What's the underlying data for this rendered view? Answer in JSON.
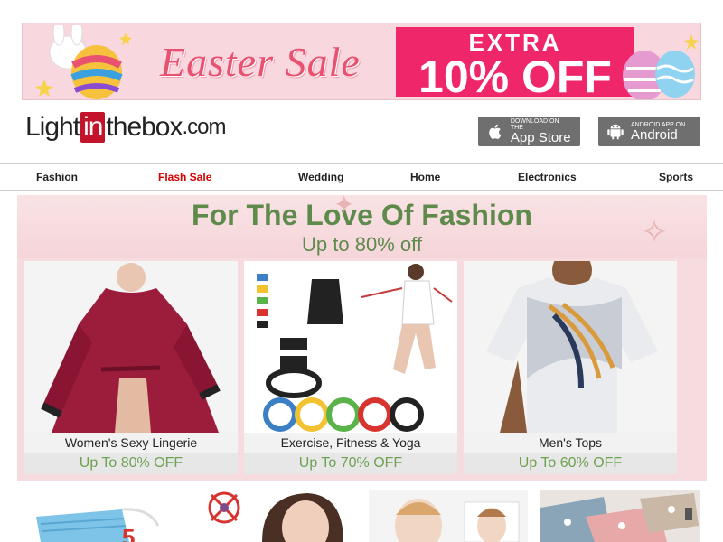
{
  "banner": {
    "title": "Easter Sale",
    "offer_line1": "EXTRA",
    "offer_line2": "10% OFF"
  },
  "header": {
    "logo_pre": "Light",
    "logo_in": "in",
    "logo_post": "thebox",
    "logo_tld": ".com",
    "appstore_small": "Download on the",
    "appstore_big": "App Store",
    "android_small": "ANDROID APP ON",
    "android_big": "Android"
  },
  "nav": {
    "items": [
      "Fashion",
      "Flash Sale",
      "Wedding",
      "Home",
      "Electronics",
      "Sports"
    ]
  },
  "promo": {
    "title": "For The Love Of Fashion",
    "subtitle": "Up to 80% off",
    "cards": [
      {
        "name": "Women's Sexy Lingerie",
        "offer": "Up To 80% OFF"
      },
      {
        "name": "Exercise, Fitness & Yoga",
        "offer": "Up To 70% OFF"
      },
      {
        "name": "Men's Tops",
        "offer": "Up To 60% OFF"
      }
    ]
  },
  "colors": {
    "accent_red": "#d40000",
    "offer_green": "#6ea253",
    "title_green": "#5e8a4c",
    "offer_pink": "#f0266a"
  }
}
